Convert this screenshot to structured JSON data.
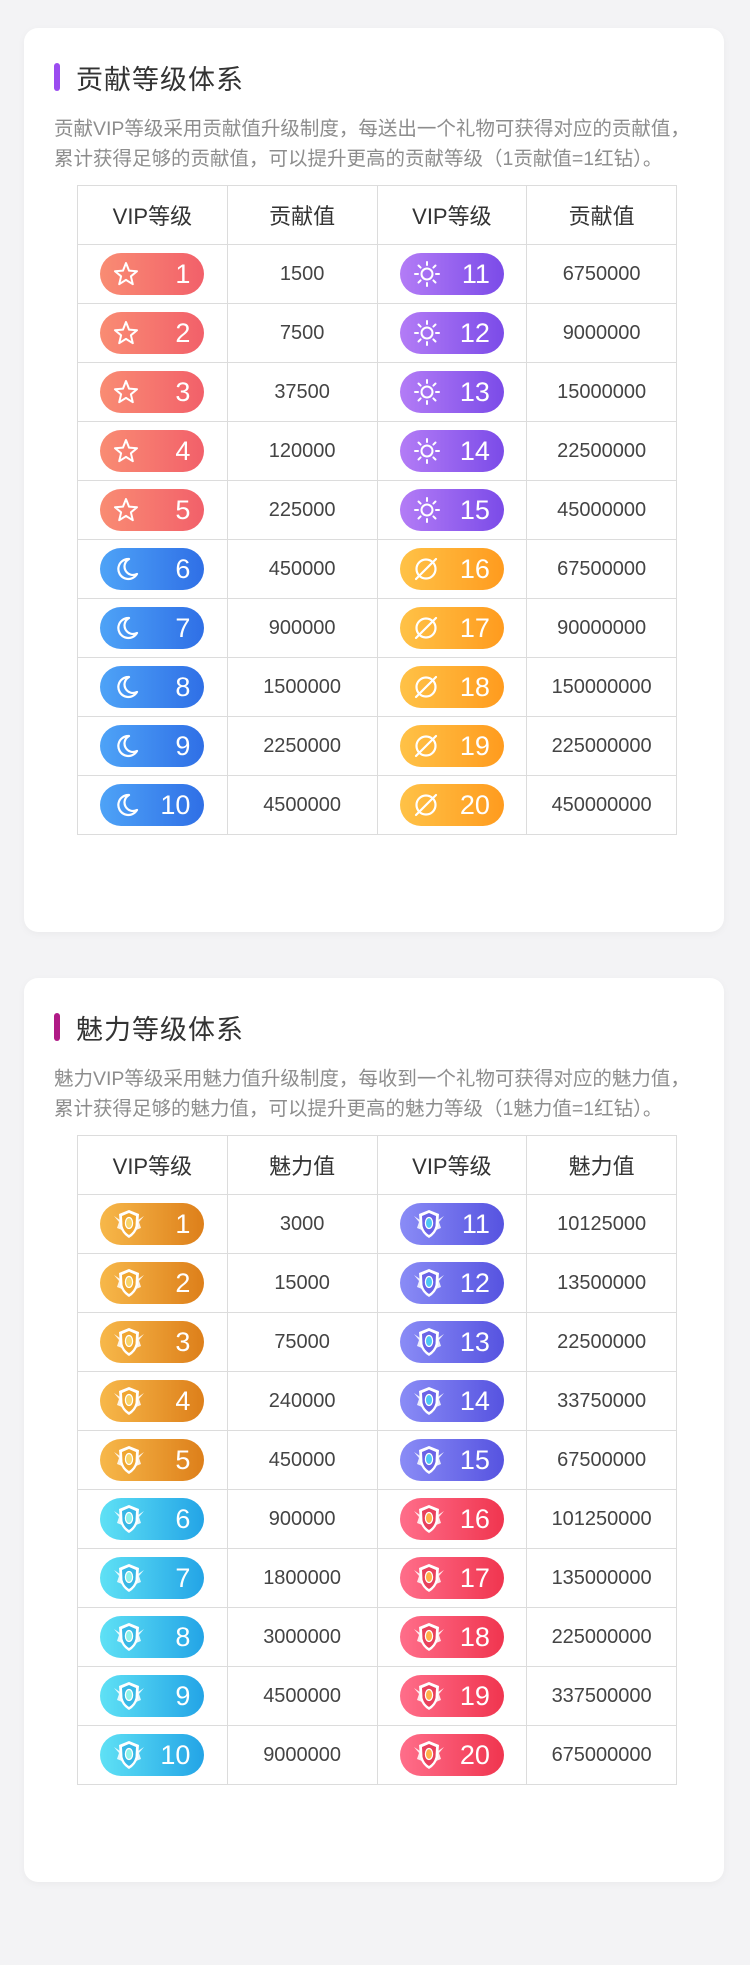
{
  "contribution": {
    "title": "贡献等级体系",
    "accent": "#9b4cf0",
    "description": "贡献VIP等级采用贡献值升级制度，每送出一个礼物可获得对应的贡献值，累计获得足够的贡献值，可以提升更高的贡献等级（1贡献值=1红钻）。",
    "headers": [
      "VIP等级",
      "贡献值",
      "VIP等级",
      "贡献值"
    ],
    "rows": [
      {
        "l1": "1",
        "v1": "1500",
        "l2": "11",
        "v2": "6750000"
      },
      {
        "l1": "2",
        "v1": "7500",
        "l2": "12",
        "v2": "9000000"
      },
      {
        "l1": "3",
        "v1": "37500",
        "l2": "13",
        "v2": "15000000"
      },
      {
        "l1": "4",
        "v1": "120000",
        "l2": "14",
        "v2": "22500000"
      },
      {
        "l1": "5",
        "v1": "225000",
        "l2": "15",
        "v2": "45000000"
      },
      {
        "l1": "6",
        "v1": "450000",
        "l2": "16",
        "v2": "67500000"
      },
      {
        "l1": "7",
        "v1": "900000",
        "l2": "17",
        "v2": "90000000"
      },
      {
        "l1": "8",
        "v1": "1500000",
        "l2": "18",
        "v2": "150000000"
      },
      {
        "l1": "9",
        "v1": "2250000",
        "l2": "19",
        "v2": "225000000"
      },
      {
        "l1": "10",
        "v1": "4500000",
        "l2": "20",
        "v2": "450000000"
      }
    ],
    "badge_icons": {
      "1-5": "star-icon",
      "6-10": "moon-icon",
      "11-15": "sun-icon",
      "16-20": "planet-icon"
    }
  },
  "charm": {
    "title": "魅力等级体系",
    "accent": "#b01a86",
    "description": "魅力VIP等级采用魅力值升级制度，每收到一个礼物可获得对应的魅力值，累计获得足够的魅力值，可以提升更高的魅力等级（1魅力值=1红钻）。",
    "headers": [
      "VIP等级",
      "魅力值",
      "VIP等级",
      "魅力值"
    ],
    "rows": [
      {
        "l1": "1",
        "v1": "3000",
        "l2": "11",
        "v2": "10125000"
      },
      {
        "l1": "2",
        "v1": "15000",
        "l2": "12",
        "v2": "13500000"
      },
      {
        "l1": "3",
        "v1": "75000",
        "l2": "13",
        "v2": "22500000"
      },
      {
        "l1": "4",
        "v1": "240000",
        "l2": "14",
        "v2": "33750000"
      },
      {
        "l1": "5",
        "v1": "450000",
        "l2": "15",
        "v2": "67500000"
      },
      {
        "l1": "6",
        "v1": "900000",
        "l2": "16",
        "v2": "101250000"
      },
      {
        "l1": "7",
        "v1": "1800000",
        "l2": "17",
        "v2": "135000000"
      },
      {
        "l1": "8",
        "v1": "3000000",
        "l2": "18",
        "v2": "225000000"
      },
      {
        "l1": "9",
        "v1": "4500000",
        "l2": "19",
        "v2": "337500000"
      },
      {
        "l1": "10",
        "v1": "9000000",
        "l2": "20",
        "v2": "675000000"
      }
    ],
    "badge_icons": {
      "1-10": "shield-badge-icon",
      "11-20": "shield-badge-icon"
    }
  }
}
